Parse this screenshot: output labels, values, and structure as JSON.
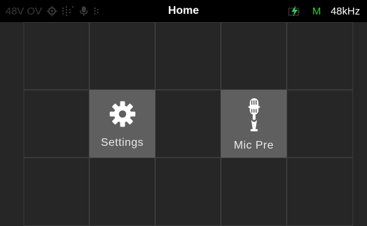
{
  "statusbar": {
    "phantom_label": "48V OV",
    "title": "Home",
    "channel_indicator": "M",
    "sample_rate": "48kHz",
    "colors": {
      "phantom_dim": "#3a3a3a",
      "power_green": "#34c759",
      "indicator_green": "#2ecc40"
    },
    "icons": [
      "gear-icon",
      "meter-icon",
      "microphone-icon",
      "battery-charging-icon"
    ]
  },
  "tiles": [
    {
      "label": "Settings",
      "icon": "gear-icon"
    },
    {
      "label": "Mic Pre",
      "icon": "microphone-icon"
    }
  ]
}
